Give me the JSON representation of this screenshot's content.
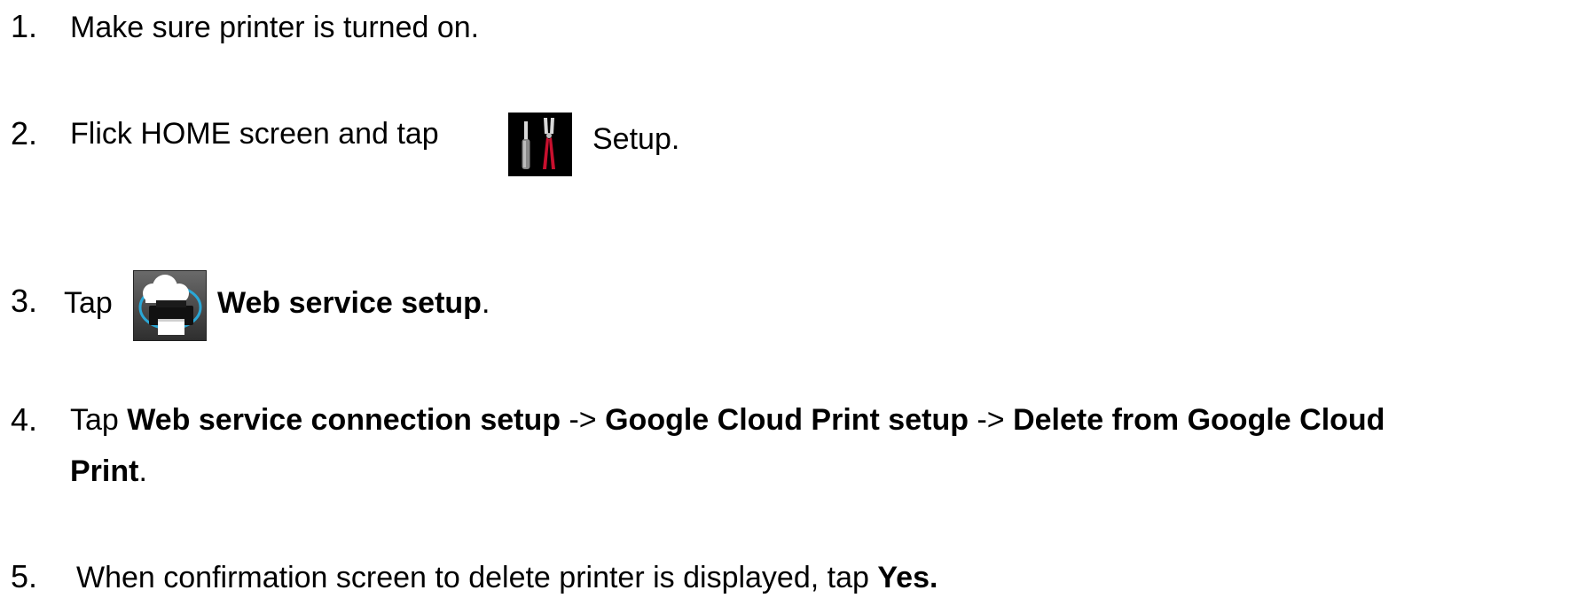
{
  "steps": [
    {
      "number": "1.",
      "text": "Make sure printer is turned on."
    },
    {
      "number": "2.",
      "text_before": "Flick HOME screen and tap",
      "icon": "setup-tools-icon",
      "text_after": "Setup."
    },
    {
      "number": "3.",
      "text_before": "Tap",
      "icon": "web-service-cloud-printer-icon",
      "bold": "Web service setup",
      "text_after": "."
    },
    {
      "number": "4.",
      "tap": "Tap",
      "bold1": "Web service connection setup",
      "arrow1": "->",
      "bold2": "Google Cloud Print setup",
      "arrow2": "->",
      "bold3a": "Delete from Google Cloud",
      "bold3b": "Print",
      "period": "."
    },
    {
      "number": "5.",
      "text": "When confirmation screen to delete printer is displayed, tap",
      "bold": "Yes."
    }
  ],
  "colors": {
    "text": "#000000",
    "icon_bg": "#000000",
    "tool_red": "#c8102e",
    "cloud_accent": "#2aa7d6"
  }
}
